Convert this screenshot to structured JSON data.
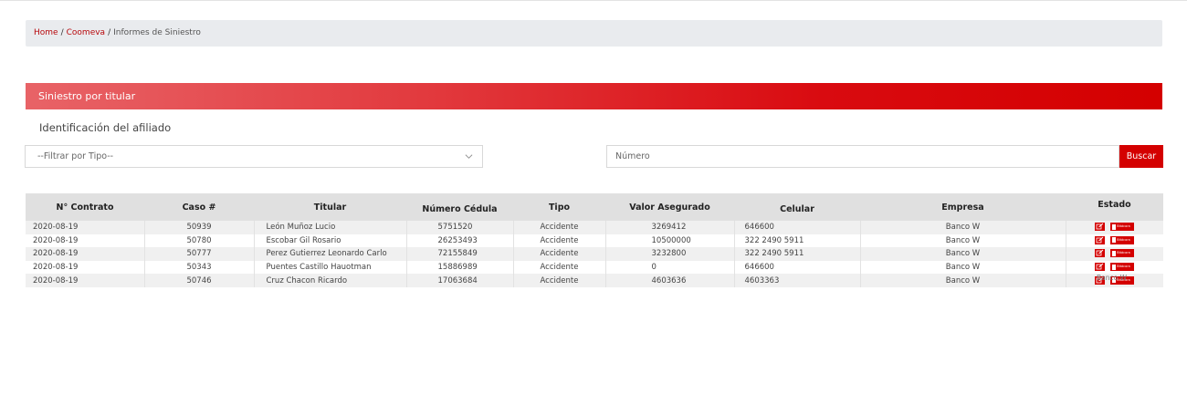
{
  "breadcrumb": {
    "home": "Home",
    "sep1": "/",
    "company": "Coomeva",
    "sep2": "/",
    "current": "Informes de Siniestro"
  },
  "section": {
    "title": "Siniestro por titular",
    "subtitle": "Identificación del afiliado"
  },
  "filters": {
    "type_select_value": "--Filtrar por Tipo--",
    "number_placeholder": "Número",
    "search_label": "Buscar"
  },
  "table": {
    "headers": [
      "N° Contrato",
      "Caso #",
      "Titular",
      "Número Cédula",
      "Tipo",
      "Valor Asegurado",
      "Celular",
      "Empresa",
      "Estado"
    ],
    "rows": [
      {
        "contrato": "2020-08-19",
        "caso": "50939",
        "titular": "León Muñoz Lucio",
        "cedula": "5751520",
        "tipo": "Accidente",
        "valor": "3269412",
        "celular": "646600",
        "empresa": "Banco W",
        "doc_label": "Bitácora"
      },
      {
        "contrato": "2020-08-19",
        "caso": "50780",
        "titular": "Escobar Gil Rosario",
        "cedula": "26253493",
        "tipo": "Accidente",
        "valor": "10500000",
        "celular": "322 2490 5911",
        "empresa": "Banco W",
        "doc_label": "Bitácora"
      },
      {
        "contrato": "2020-08-19",
        "caso": "50777",
        "titular": "Perez Gutierrez Leonardo Carlo",
        "cedula": "72155849",
        "tipo": "Accidente",
        "valor": "3232800",
        "celular": "322 2490 5911",
        "empresa": "Banco W",
        "doc_label": "Bitácora"
      },
      {
        "contrato": "2020-08-19",
        "caso": "50343",
        "titular": "Puentes Castillo Hauotman",
        "cedula": "15886989",
        "tipo": "Accidente",
        "valor": "0",
        "celular": "646600",
        "empresa": "Banco W",
        "doc_label": "Bitácora"
      },
      {
        "contrato": "2020-08-19",
        "caso": "50746",
        "titular": "Cruz Chacon Ricardo",
        "cedula": "17063684",
        "tipo": "Accidente",
        "valor": "4603636",
        "celular": "4603363",
        "empresa": "Banco W",
        "doc_label": "Bitácora"
      }
    ],
    "overlap_text": "Banco W"
  },
  "icons": {
    "edit": "edit-icon",
    "document": "document-icon",
    "dropdown": "chevron-down-icon"
  },
  "colors": {
    "brand_red": "#d40000",
    "link_red": "#b8080c",
    "header_gradient_start": "#e86367",
    "breadcrumb_bg": "#e9ebee",
    "table_header_bg": "#e0e0e0"
  }
}
